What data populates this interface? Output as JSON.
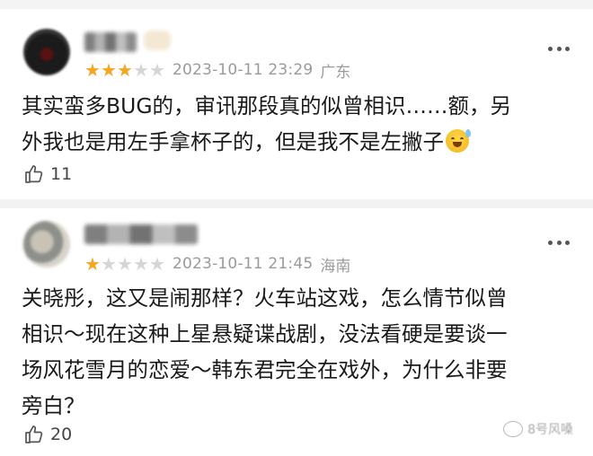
{
  "comments": [
    {
      "rating": 3,
      "max_rating": 5,
      "timestamp": "2023-10-11 23:29",
      "location": "广东",
      "text_line1": "其实蛮多BUG的，审讯那段真的似曾相识……额，另",
      "text_line2": "外我也是用左手拿杯子的，但是我不是左撇子",
      "emoji": "sweat-smile-icon",
      "likes": "11"
    },
    {
      "rating": 1,
      "max_rating": 5,
      "timestamp": "2023-10-11 21:45",
      "location": "海南",
      "text_lines": [
        "关晓彤，这又是闹那样？火车站这戏，怎么情节似曾",
        "相识～现在这种上星悬疑谍战剧，没法看硬是要谈一",
        "场风花雪月的恋爱～韩东君完全在戏外，为什么非要",
        "旁白？"
      ],
      "likes": "20"
    }
  ],
  "watermark": {
    "text": "8号风嗓"
  },
  "colors": {
    "star_on": "#f5a623",
    "star_off": "#d6d6d6",
    "meta": "#9a9a9a"
  }
}
